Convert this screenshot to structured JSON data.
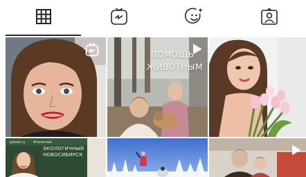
{
  "profile_tabs": [
    {
      "name": "posts",
      "icon": "grid-icon",
      "selected": true
    },
    {
      "name": "igtv",
      "icon": "igtv-icon",
      "selected": false
    },
    {
      "name": "effects",
      "icon": "effects-icon",
      "selected": false
    },
    {
      "name": "tagged",
      "icon": "tagged-user-icon",
      "selected": false
    }
  ],
  "posts": [
    {
      "id": 1,
      "type": "igtv",
      "badge_icon": "igtv-badge-icon"
    },
    {
      "id": 2,
      "type": "video",
      "badge_icon": "play-icon",
      "caption_lines": [
        "ПОМОЩЬ",
        "ЖИВОТНЫМ"
      ]
    },
    {
      "id": 3,
      "type": "photo"
    },
    {
      "id": 4,
      "type": "photo",
      "sign_lines": [
        "ЭКОЛОГИЧНЫЙ",
        "НОВОСИБИРСК"
      ],
      "sign_left": "pdvde.ru",
      "sign_right": "#зеленый"
    },
    {
      "id": 5,
      "type": "photo"
    },
    {
      "id": 6,
      "type": "video",
      "badge_icon": "play-icon"
    }
  ],
  "colors": {
    "icon": "#262626",
    "selected_underline": "#262626",
    "background": "#ffffff"
  }
}
